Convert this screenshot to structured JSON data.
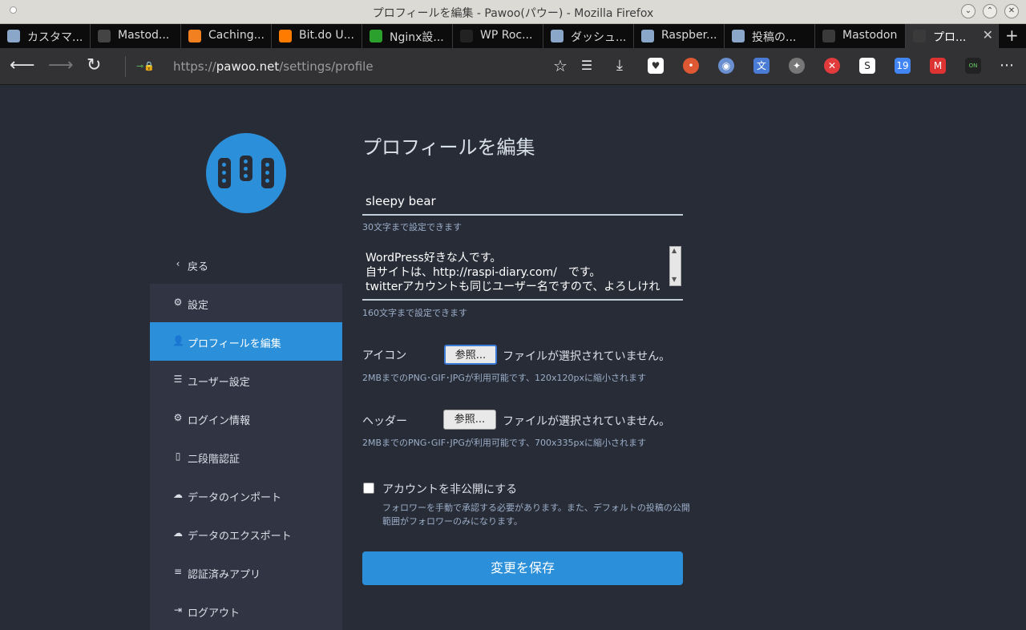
{
  "window": {
    "title": "プロフィールを編集 - Pawoo(パウー) - Mozilla Firefox"
  },
  "tabs": [
    {
      "label": "カスタマ...",
      "icon": "image-icon",
      "color": "#8aa6c8"
    },
    {
      "label": "Mastod...",
      "icon": "github-icon",
      "color": "#444444"
    },
    {
      "label": "Caching...",
      "icon": "cloudflare-icon",
      "color": "#f38020"
    },
    {
      "label": "Bit.do U...",
      "icon": "bitdo-icon",
      "color": "#ff7b00"
    },
    {
      "label": "Nginx設...",
      "icon": "nginx-icon",
      "color": "#2ca02c"
    },
    {
      "label": "WP Roc...",
      "icon": "wprocket-icon",
      "color": "#222222"
    },
    {
      "label": "ダッシュ...",
      "icon": "image-icon",
      "color": "#8aa6c8"
    },
    {
      "label": "Raspber...",
      "icon": "image-icon",
      "color": "#8aa6c8"
    },
    {
      "label": "投稿の...",
      "icon": "image-icon",
      "color": "#8aa6c8"
    },
    {
      "label": "Mastodon",
      "icon": "mastodon-icon",
      "color": "#3a3a3a"
    },
    {
      "label": "プロ...",
      "icon": "pawoo-icon",
      "color": "#3a3a3a",
      "active": true
    }
  ],
  "nav": {
    "url_prefix": "https://",
    "url_host": "pawoo.net",
    "url_path": "/settings/profile"
  },
  "sidebar": {
    "back_label": "戻る",
    "items": [
      {
        "label": "設定",
        "icon": "gear-icon",
        "glyph": "⚙"
      },
      {
        "label": "プロフィールを編集",
        "icon": "user-icon",
        "glyph": "👤",
        "active": true
      },
      {
        "label": "ユーザー設定",
        "icon": "sliders-icon",
        "glyph": "☰"
      },
      {
        "label": "ログイン情報",
        "icon": "gear-icon",
        "glyph": "⚙"
      },
      {
        "label": "二段階認証",
        "icon": "mobile-icon",
        "glyph": "▯"
      },
      {
        "label": "データのインポート",
        "icon": "cloud-upload-icon",
        "glyph": "☁"
      },
      {
        "label": "データのエクスポート",
        "icon": "cloud-download-icon",
        "glyph": "☁"
      },
      {
        "label": "認証済みアプリ",
        "icon": "list-icon",
        "glyph": "≡"
      },
      {
        "label": "ログアウト",
        "icon": "sign-out-icon",
        "glyph": "⇥"
      }
    ]
  },
  "main": {
    "title": "プロフィールを編集",
    "display_name": "sleepy bear",
    "display_name_hint": "30文字まで設定できます",
    "bio": "WordPress好きな人です。\n自サイトは、http://raspi-diary.com/　です。\ntwitterアカウントも同じユーザー名ですので、よろしけれ",
    "bio_hint": "160文字まで設定できます",
    "avatar_label": "アイコン",
    "header_label": "ヘッダー",
    "browse_label": "参照...",
    "no_file": "ファイルが選択されていません。",
    "avatar_hint": "2MBまでのPNG･GIF･JPGが利用可能です、120x120pxに縮小されます",
    "header_hint": "2MBまでのPNG･GIF･JPGが利用可能です、700x335pxに縮小されます",
    "locked_label": "アカウントを非公開にする",
    "locked_hint_1": "フォロワーを手動で承認する必要があります。また、デフォルトの投稿の公開",
    "locked_hint_2": "範囲がフォロワーのみになります。",
    "save_label": "変更を保存"
  }
}
